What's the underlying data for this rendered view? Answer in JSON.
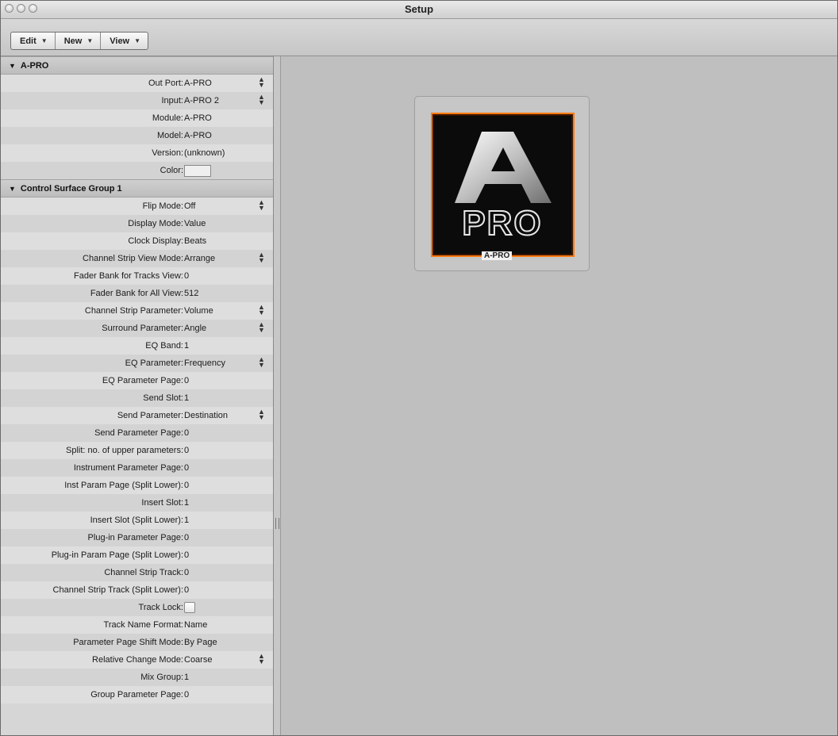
{
  "window": {
    "title": "Setup"
  },
  "toolbar": {
    "edit": "Edit",
    "new": "New",
    "view": "View"
  },
  "inspector": {
    "device_header": "A-PRO",
    "device_rows": [
      {
        "label": "Out Port:",
        "value": "A-PRO"
      },
      {
        "label": "Input:",
        "value": "A-PRO 2"
      },
      {
        "label": "Module:",
        "value": "A-PRO"
      },
      {
        "label": "Model:",
        "value": "A-PRO"
      },
      {
        "label": "Version:",
        "value": "(unknown)"
      },
      {
        "label": "Color:"
      }
    ],
    "group_header": "Control Surface Group 1",
    "group_rows": [
      {
        "label": "Flip Mode:",
        "value": "Off"
      },
      {
        "label": "Display Mode:",
        "value": "Value"
      },
      {
        "label": "Clock Display:",
        "value": "Beats"
      },
      {
        "label": "Channel Strip View Mode:",
        "value": "Arrange"
      },
      {
        "label": "Fader Bank for Tracks View:",
        "value": "0"
      },
      {
        "label": "Fader Bank for All View:",
        "value": "512"
      },
      {
        "label": "Channel Strip Parameter:",
        "value": "Volume"
      },
      {
        "label": "Surround Parameter:",
        "value": "Angle"
      },
      {
        "label": "EQ Band:",
        "value": "1"
      },
      {
        "label": "EQ Parameter:",
        "value": "Frequency"
      },
      {
        "label": "EQ Parameter Page:",
        "value": "0"
      },
      {
        "label": "Send Slot:",
        "value": "1"
      },
      {
        "label": "Send Parameter:",
        "value": "Destination"
      },
      {
        "label": "Send Parameter Page:",
        "value": "0"
      },
      {
        "label": "Split: no. of upper parameters:",
        "value": "0"
      },
      {
        "label": "Instrument Parameter Page:",
        "value": "0"
      },
      {
        "label": "Inst Param Page (Split Lower):",
        "value": "0"
      },
      {
        "label": "Insert Slot:",
        "value": "1"
      },
      {
        "label": "Insert Slot (Split Lower):",
        "value": "1"
      },
      {
        "label": "Plug-in Parameter Page:",
        "value": "0"
      },
      {
        "label": "Plug-in Param Page (Split Lower):",
        "value": "0"
      },
      {
        "label": "Channel Strip Track:",
        "value": "0"
      },
      {
        "label": "Channel Strip Track (Split Lower):",
        "value": "0"
      },
      {
        "label": "Track Lock:"
      },
      {
        "label": "Track Name Format:",
        "value": "Name"
      },
      {
        "label": "Parameter Page Shift Mode:",
        "value": "By Page"
      },
      {
        "label": "Relative Change Mode:",
        "value": "Coarse"
      },
      {
        "label": "Mix Group:",
        "value": "1"
      },
      {
        "label": "Group Parameter Page:",
        "value": "0"
      }
    ]
  },
  "canvas": {
    "device_label": "A-PRO",
    "logo_letter": "A",
    "logo_text": "PRO"
  },
  "colors": {
    "device_border": "#ff7a10",
    "device_bg": "#0b0b0b"
  },
  "icons": {
    "popup": "up-down-arrows-icon",
    "menu": "triangle-down-icon",
    "disclosure": "disclosure-triangle-icon"
  }
}
